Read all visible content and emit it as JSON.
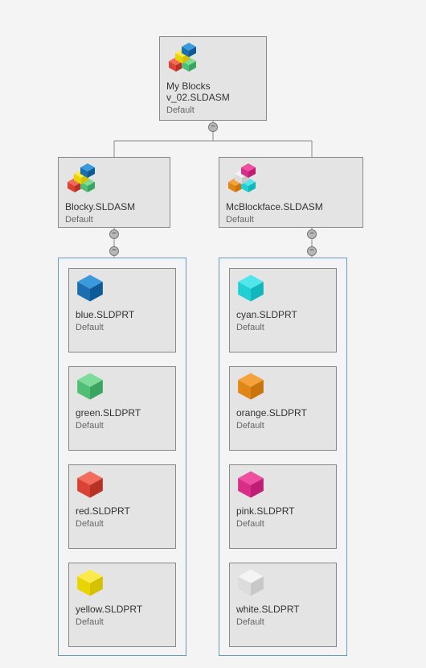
{
  "root": {
    "title": "My Blocks v_02.SLDASM",
    "config": "Default"
  },
  "subs": [
    {
      "title": "Blocky.SLDASM",
      "config": "Default",
      "parts": [
        {
          "title": "blue.SLDPRT",
          "config": "Default",
          "color": "blue"
        },
        {
          "title": "green.SLDPRT",
          "config": "Default",
          "color": "green"
        },
        {
          "title": "red.SLDPRT",
          "config": "Default",
          "color": "red"
        },
        {
          "title": "yellow.SLDPRT",
          "config": "Default",
          "color": "yellow"
        }
      ]
    },
    {
      "title": "McBlockface.SLDASM",
      "config": "Default",
      "parts": [
        {
          "title": "cyan.SLDPRT",
          "config": "Default",
          "color": "cyan"
        },
        {
          "title": "orange.SLDPRT",
          "config": "Default",
          "color": "orange"
        },
        {
          "title": "pink.SLDPRT",
          "config": "Default",
          "color": "pink"
        },
        {
          "title": "white.SLDPRT",
          "config": "Default",
          "color": "white"
        }
      ]
    }
  ],
  "cube_colors": {
    "blue": {
      "top": "#3a9bdc",
      "left": "#1b6fb0",
      "right": "#0d5a97"
    },
    "green": {
      "top": "#7edc9a",
      "left": "#4fbf76",
      "right": "#3aa561"
    },
    "red": {
      "top": "#f26b5b",
      "left": "#d94234",
      "right": "#b83125"
    },
    "yellow": {
      "top": "#fbe94e",
      "left": "#e9d400",
      "right": "#d4c100"
    },
    "cyan": {
      "top": "#51e7ea",
      "left": "#1fd0d4",
      "right": "#12b7bb"
    },
    "orange": {
      "top": "#f5a23c",
      "left": "#e18514",
      "right": "#c9740c"
    },
    "pink": {
      "top": "#ef4fa1",
      "left": "#d92e88",
      "right": "#c01e76"
    },
    "white": {
      "top": "#f4f4f4",
      "left": "#dcdcdc",
      "right": "#c8c8c8"
    }
  },
  "asm_icon_colors": {
    "root_and_sub1": [
      {
        "top": "#f26b5b",
        "left": "#d94234",
        "right": "#b83125"
      },
      {
        "top": "#7edc9a",
        "left": "#4fbf76",
        "right": "#3aa561"
      },
      {
        "top": "#fbe94e",
        "left": "#e9d400",
        "right": "#d4c100"
      },
      {
        "top": "#3a9bdc",
        "left": "#1b6fb0",
        "right": "#0d5a97"
      }
    ],
    "sub2": [
      {
        "top": "#f5a23c",
        "left": "#e18514",
        "right": "#c9740c"
      },
      {
        "top": "#51e7ea",
        "left": "#1fd0d4",
        "right": "#12b7bb"
      },
      {
        "top": "#f4f4f4",
        "left": "#dcdcdc",
        "right": "#c8c8c8"
      },
      {
        "top": "#ef4fa1",
        "left": "#d92e88",
        "right": "#c01e76"
      }
    ]
  },
  "collapse_glyph": "−"
}
